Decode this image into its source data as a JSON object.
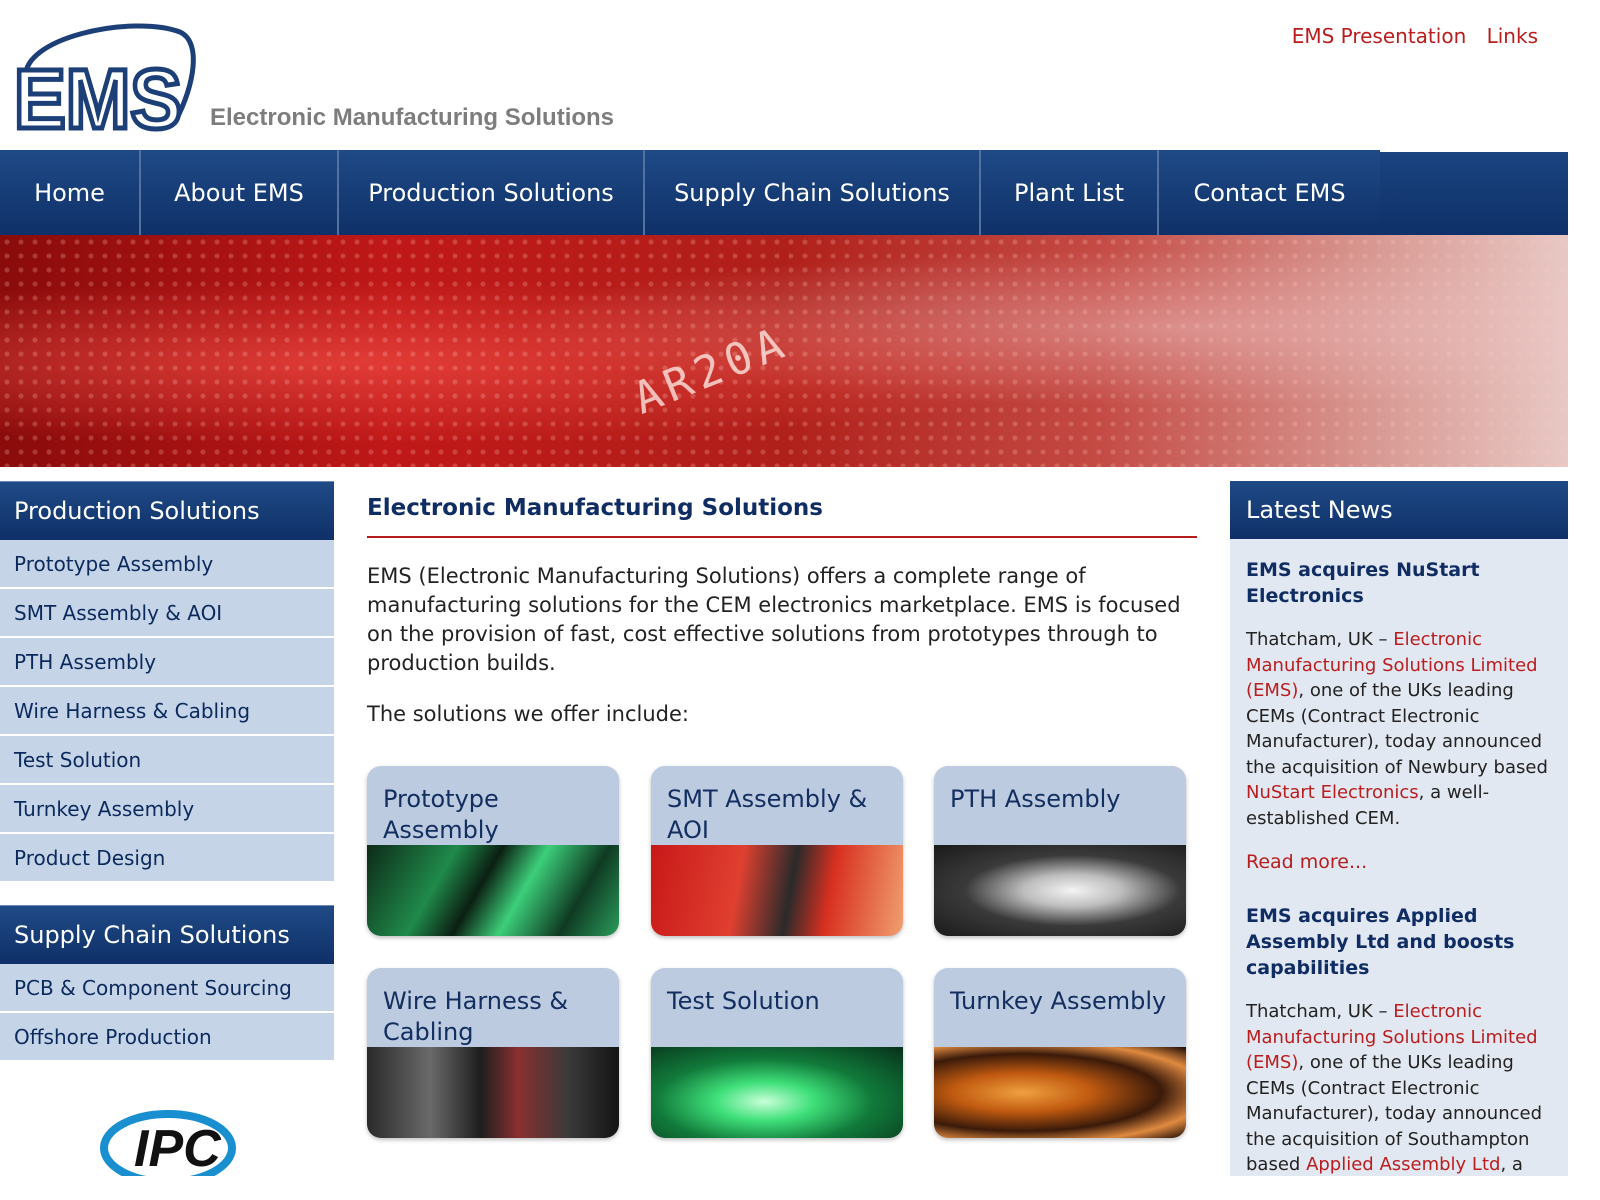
{
  "header": {
    "logo_text": "EMS",
    "tagline": "Electronic Manufacturing Solutions",
    "top_links": [
      "EMS Presentation",
      "Links"
    ]
  },
  "nav": {
    "items": [
      "Home",
      "About EMS",
      "Production Solutions",
      "Supply Chain Solutions",
      "Plant List",
      "Contact EMS"
    ]
  },
  "banner": {
    "text": "AR20A"
  },
  "sidebar": {
    "production": {
      "heading": "Production Solutions",
      "items": [
        "Prototype Assembly",
        "SMT Assembly & AOI",
        "PTH Assembly",
        "Wire Harness & Cabling",
        "Test Solution",
        "Turnkey Assembly",
        "Product Design"
      ]
    },
    "supply": {
      "heading": "Supply Chain Solutions",
      "items": [
        "PCB & Component Sourcing",
        "Offshore Production"
      ]
    },
    "badge": "IPC"
  },
  "main": {
    "title": "Electronic Manufacturing Solutions",
    "intro": "EMS (Electronic Manufacturing Solutions) offers a complete range of manufacturing solutions for the CEM electronics marketplace.  EMS is focused on the provision of fast, cost effective solutions from prototypes through to production builds.",
    "offer": "The solutions we offer include:",
    "tiles": [
      "Prototype Assembly",
      "SMT Assembly & AOI",
      "PTH Assembly",
      "Wire Harness & Cabling",
      "Test Solution",
      "Turnkey Assembly"
    ]
  },
  "news": {
    "heading": "Latest News",
    "items": [
      {
        "title": "EMS acquires NuStart Electronics",
        "t1": "Thatcham, UK – ",
        "link1": "Electronic Manufacturing Solutions Limited (EMS)",
        "t2": ", one of the UKs leading CEMs (Contract Electronic Manufacturer), today announced the acquisition of Newbury based ",
        "link2": "NuStart Electronics",
        "t3": ", a well-established CEM.",
        "read_more": "Read more..."
      },
      {
        "title": "EMS acquires Applied Assembly Ltd and boosts capabilities",
        "t1": "Thatcham, UK – ",
        "link1": "Electronic Manufacturing Solutions Limited (EMS)",
        "t2": ", one of the UKs leading CEMs (Contract Electronic Manufacturer), today announced the acquisition of Southampton based ",
        "link2": "Applied Assembly Ltd",
        "t3": ", a"
      }
    ]
  },
  "colors": {
    "brand_blue": "#0f3068",
    "link_red": "#b91d1d",
    "panel_blue": "#c6d4e8"
  }
}
